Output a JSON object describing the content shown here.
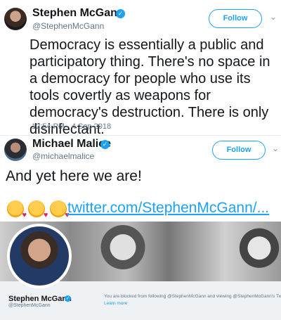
{
  "tweet": {
    "author_name": "Stephen McGann",
    "author_handle": "@StephenMcGann",
    "follow_label": "Follow",
    "text": "Democracy is essentially a public and participatory thing. There's no space in a democracy for people who use its tools covertly as weapons for democracy's destruction. There is only disinfectant.",
    "timestamp": "12:54 PM - 4 Sep 2018"
  },
  "reply": {
    "author_name": "Michael Malice",
    "author_handle": "@michaelmalice",
    "follow_label": "Follow",
    "text": "And yet here we are!",
    "emoji": [
      "kissing-face-heart",
      "kissing-face-heart",
      "kissing-face-heart"
    ],
    "link_text": "twitter.com/StephenMcGann/..."
  },
  "card": {
    "profile_name": "Stephen McGann",
    "profile_handle": "@StephenMcGann",
    "blocked_notice": "You are blocked from following @StephenMcGann and viewing @StephenMcGann's Tweets.",
    "learn_more": "Learn more"
  },
  "colors": {
    "accent": "#1da1f2",
    "muted": "#657786",
    "text": "#14171a"
  },
  "icons": {
    "verified": "verified-badge-icon",
    "chevron": "chevron-down-icon"
  }
}
